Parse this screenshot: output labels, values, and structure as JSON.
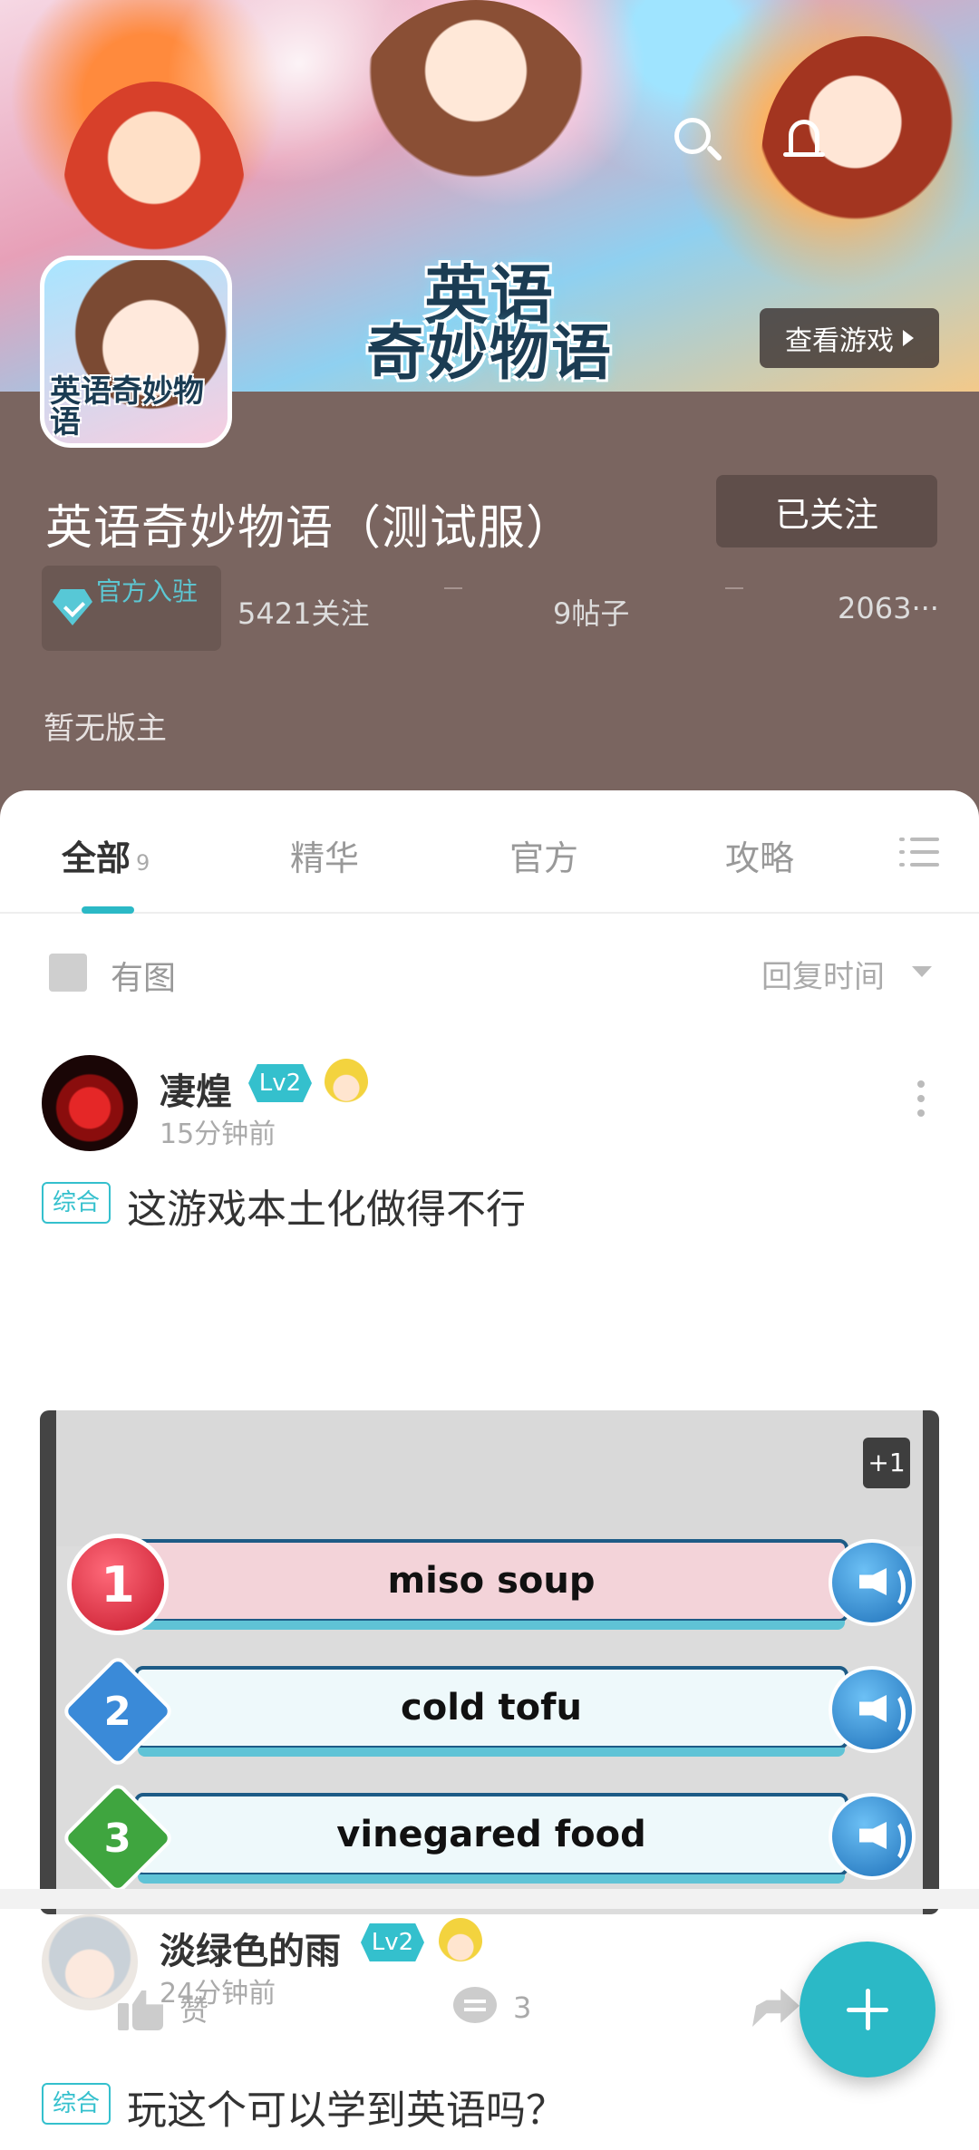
{
  "banner": {
    "logo_line1": "英语",
    "logo_line2": "奇妙物语",
    "view_game_label": "查看游戏"
  },
  "game": {
    "icon_text": "英语奇妙物语",
    "title": "英语奇妙物语（测试服）",
    "follow_label": "已关注",
    "official_label": "官方入驻",
    "stats": {
      "followers": "5421关注",
      "posts": "9帖子",
      "third": "2063···"
    },
    "owner_text": "暂无版主"
  },
  "tabs": [
    {
      "label": "全部",
      "count": "9"
    },
    {
      "label": "精华"
    },
    {
      "label": "官方"
    },
    {
      "label": "攻略"
    }
  ],
  "filter": {
    "has_image_label": "有图",
    "sort_label": "回复时间"
  },
  "posts": [
    {
      "username": "凄煌",
      "level": "Lv2",
      "time": "15分钟前",
      "tag": "综合",
      "title": "这游戏本土化做得不行",
      "screenshot": {
        "plus_label": "+1",
        "answers": [
          {
            "num": "1",
            "text": "miso soup"
          },
          {
            "num": "2",
            "text": "cold tofu"
          },
          {
            "num": "3",
            "text": "vinegared food"
          }
        ]
      },
      "actions": {
        "like_label": "赞",
        "comment_count": "3",
        "share_label": "分享"
      }
    },
    {
      "username": "淡绿色的雨",
      "level": "Lv2",
      "time": "24分钟前",
      "tag": "综合",
      "title": "玩这个可以学到英语吗？"
    }
  ],
  "icons": {
    "search": "search-icon",
    "bell": "bell-icon",
    "menu": "list-menu-icon",
    "more": "more-vertical-icon",
    "fab": "plus-icon"
  },
  "colors": {
    "accent": "#2bb9c6",
    "header_bg": "#7a6560"
  }
}
